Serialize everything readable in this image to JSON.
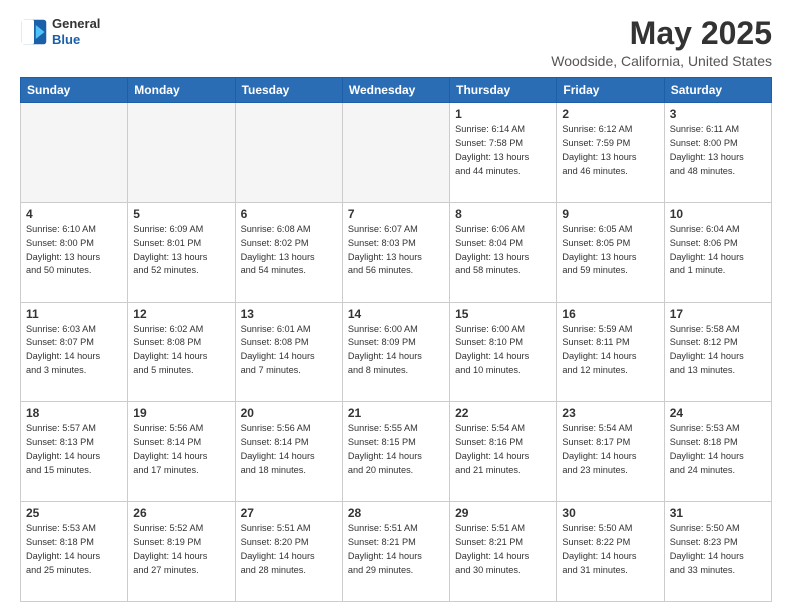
{
  "header": {
    "logo": {
      "general": "General",
      "blue": "Blue"
    },
    "title": "May 2025",
    "subtitle": "Woodside, California, United States"
  },
  "weekdays": [
    "Sunday",
    "Monday",
    "Tuesday",
    "Wednesday",
    "Thursday",
    "Friday",
    "Saturday"
  ],
  "weeks": [
    [
      {
        "day": "",
        "info": ""
      },
      {
        "day": "",
        "info": ""
      },
      {
        "day": "",
        "info": ""
      },
      {
        "day": "",
        "info": ""
      },
      {
        "day": "1",
        "info": "Sunrise: 6:14 AM\nSunset: 7:58 PM\nDaylight: 13 hours\nand 44 minutes."
      },
      {
        "day": "2",
        "info": "Sunrise: 6:12 AM\nSunset: 7:59 PM\nDaylight: 13 hours\nand 46 minutes."
      },
      {
        "day": "3",
        "info": "Sunrise: 6:11 AM\nSunset: 8:00 PM\nDaylight: 13 hours\nand 48 minutes."
      }
    ],
    [
      {
        "day": "4",
        "info": "Sunrise: 6:10 AM\nSunset: 8:00 PM\nDaylight: 13 hours\nand 50 minutes."
      },
      {
        "day": "5",
        "info": "Sunrise: 6:09 AM\nSunset: 8:01 PM\nDaylight: 13 hours\nand 52 minutes."
      },
      {
        "day": "6",
        "info": "Sunrise: 6:08 AM\nSunset: 8:02 PM\nDaylight: 13 hours\nand 54 minutes."
      },
      {
        "day": "7",
        "info": "Sunrise: 6:07 AM\nSunset: 8:03 PM\nDaylight: 13 hours\nand 56 minutes."
      },
      {
        "day": "8",
        "info": "Sunrise: 6:06 AM\nSunset: 8:04 PM\nDaylight: 13 hours\nand 58 minutes."
      },
      {
        "day": "9",
        "info": "Sunrise: 6:05 AM\nSunset: 8:05 PM\nDaylight: 13 hours\nand 59 minutes."
      },
      {
        "day": "10",
        "info": "Sunrise: 6:04 AM\nSunset: 8:06 PM\nDaylight: 14 hours\nand 1 minute."
      }
    ],
    [
      {
        "day": "11",
        "info": "Sunrise: 6:03 AM\nSunset: 8:07 PM\nDaylight: 14 hours\nand 3 minutes."
      },
      {
        "day": "12",
        "info": "Sunrise: 6:02 AM\nSunset: 8:08 PM\nDaylight: 14 hours\nand 5 minutes."
      },
      {
        "day": "13",
        "info": "Sunrise: 6:01 AM\nSunset: 8:08 PM\nDaylight: 14 hours\nand 7 minutes."
      },
      {
        "day": "14",
        "info": "Sunrise: 6:00 AM\nSunset: 8:09 PM\nDaylight: 14 hours\nand 8 minutes."
      },
      {
        "day": "15",
        "info": "Sunrise: 6:00 AM\nSunset: 8:10 PM\nDaylight: 14 hours\nand 10 minutes."
      },
      {
        "day": "16",
        "info": "Sunrise: 5:59 AM\nSunset: 8:11 PM\nDaylight: 14 hours\nand 12 minutes."
      },
      {
        "day": "17",
        "info": "Sunrise: 5:58 AM\nSunset: 8:12 PM\nDaylight: 14 hours\nand 13 minutes."
      }
    ],
    [
      {
        "day": "18",
        "info": "Sunrise: 5:57 AM\nSunset: 8:13 PM\nDaylight: 14 hours\nand 15 minutes."
      },
      {
        "day": "19",
        "info": "Sunrise: 5:56 AM\nSunset: 8:14 PM\nDaylight: 14 hours\nand 17 minutes."
      },
      {
        "day": "20",
        "info": "Sunrise: 5:56 AM\nSunset: 8:14 PM\nDaylight: 14 hours\nand 18 minutes."
      },
      {
        "day": "21",
        "info": "Sunrise: 5:55 AM\nSunset: 8:15 PM\nDaylight: 14 hours\nand 20 minutes."
      },
      {
        "day": "22",
        "info": "Sunrise: 5:54 AM\nSunset: 8:16 PM\nDaylight: 14 hours\nand 21 minutes."
      },
      {
        "day": "23",
        "info": "Sunrise: 5:54 AM\nSunset: 8:17 PM\nDaylight: 14 hours\nand 23 minutes."
      },
      {
        "day": "24",
        "info": "Sunrise: 5:53 AM\nSunset: 8:18 PM\nDaylight: 14 hours\nand 24 minutes."
      }
    ],
    [
      {
        "day": "25",
        "info": "Sunrise: 5:53 AM\nSunset: 8:18 PM\nDaylight: 14 hours\nand 25 minutes."
      },
      {
        "day": "26",
        "info": "Sunrise: 5:52 AM\nSunset: 8:19 PM\nDaylight: 14 hours\nand 27 minutes."
      },
      {
        "day": "27",
        "info": "Sunrise: 5:51 AM\nSunset: 8:20 PM\nDaylight: 14 hours\nand 28 minutes."
      },
      {
        "day": "28",
        "info": "Sunrise: 5:51 AM\nSunset: 8:21 PM\nDaylight: 14 hours\nand 29 minutes."
      },
      {
        "day": "29",
        "info": "Sunrise: 5:51 AM\nSunset: 8:21 PM\nDaylight: 14 hours\nand 30 minutes."
      },
      {
        "day": "30",
        "info": "Sunrise: 5:50 AM\nSunset: 8:22 PM\nDaylight: 14 hours\nand 31 minutes."
      },
      {
        "day": "31",
        "info": "Sunrise: 5:50 AM\nSunset: 8:23 PM\nDaylight: 14 hours\nand 33 minutes."
      }
    ]
  ]
}
